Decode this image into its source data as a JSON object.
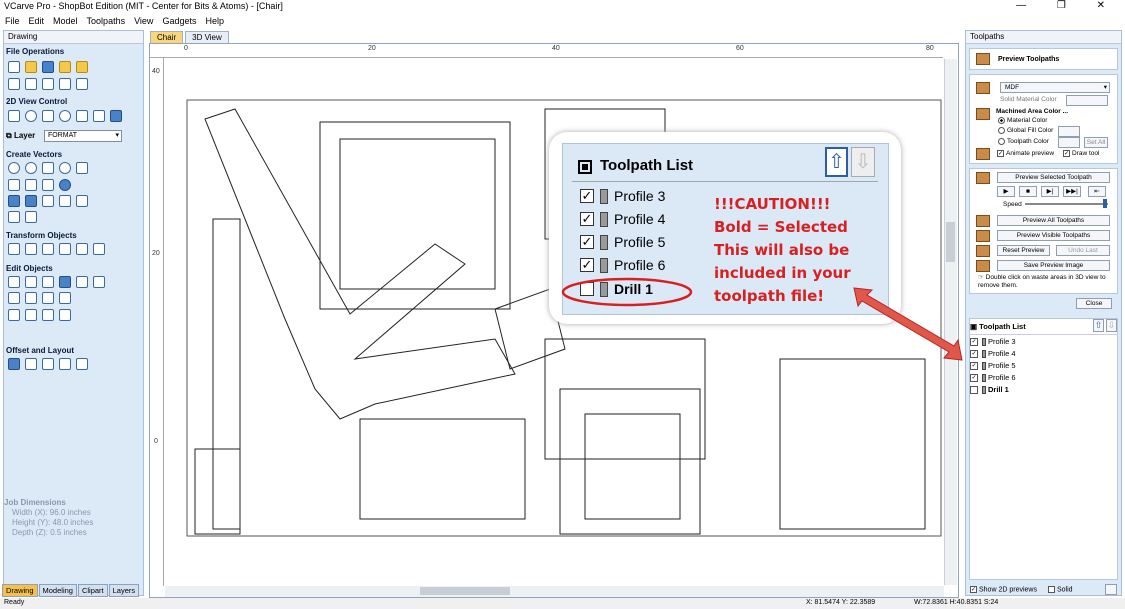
{
  "window": {
    "title": "VCarve Pro - ShopBot Edition (MIT - Center for Bits & Atoms) - [Chair]",
    "min": "—",
    "max": "❐",
    "close": "✕"
  },
  "menu": [
    "File",
    "Edit",
    "Model",
    "Toolpaths",
    "View",
    "Gadgets",
    "Help"
  ],
  "left": {
    "panel_title": "Drawing",
    "sections": {
      "file_operations": "File Operations",
      "view_control": "2D View Control",
      "layer": "Layer",
      "create_vectors": "Create Vectors",
      "transform_objects": "Transform Objects",
      "edit_objects": "Edit Objects",
      "offset_layout": "Offset and Layout"
    },
    "layer_value": "FORMAT",
    "job": {
      "heading": "Job Dimensions",
      "width": "Width  (X): 96.0 inches",
      "height": "Height (Y): 48.0 inches",
      "depth": "Depth  (Z): 0.5 inches"
    },
    "tabs": [
      "Drawing",
      "Modeling",
      "Clipart",
      "Layers"
    ]
  },
  "doc_tabs": [
    "Chair",
    "3D View"
  ],
  "ruler": {
    "h": [
      "0",
      "20",
      "40",
      "60",
      "80"
    ],
    "v": [
      "40",
      "20",
      "0"
    ]
  },
  "callout": {
    "title": "Toolpath List",
    "items": [
      {
        "label": "Profile 3",
        "check": "✓",
        "bold": false
      },
      {
        "label": "Profile 4",
        "check": "✓",
        "bold": false
      },
      {
        "label": "Profile 5",
        "check": "✓",
        "bold": false
      },
      {
        "label": "Profile 6",
        "check": "✓",
        "bold": false
      },
      {
        "label": "Drill 1",
        "check": "",
        "bold": true
      }
    ],
    "caution": [
      "!!!CAUTION!!!",
      "Bold = Selected",
      "This will also be",
      "included in your",
      "toolpath file!"
    ],
    "up_arrow": "⇧",
    "down_arrow": "⇩",
    "accent_color": "#d92020"
  },
  "right": {
    "panel_title": "Toolpaths",
    "preview_toolpaths": "Preview Toolpaths",
    "material": "MDF",
    "solid_material_color": "Solid Material Color",
    "machined_area_color": "Machined Area Color ...",
    "material_color": "Material Color",
    "global_fill_color": "Global Fill Color",
    "toolpath_color": "Toolpath Color",
    "set_all": "Set All",
    "animate_preview": "Animate preview",
    "draw_tool": "Draw tool",
    "preview_selected": "Preview Selected Toolpath",
    "playback": [
      "▶",
      "■",
      "▶|",
      "▶▶|",
      "⇤"
    ],
    "speed": "Speed",
    "preview_all": "Preview All Toolpaths",
    "preview_visible": "Preview Visible Toolpaths",
    "reset_preview": "Reset Preview",
    "undo_last": "Undo Last",
    "save_preview_image": "Save Preview Image",
    "hint": "Double click on waste areas in 3D view to remove them.",
    "close": "Close",
    "toolpath_list_title": "Toolpath List",
    "toolpath_items": [
      {
        "label": "Profile 3",
        "check": "✓",
        "bold": false
      },
      {
        "label": "Profile 4",
        "check": "✓",
        "bold": false
      },
      {
        "label": "Profile 5",
        "check": "✓",
        "bold": false
      },
      {
        "label": "Profile 6",
        "check": "✓",
        "bold": false
      },
      {
        "label": "Drill 1",
        "check": "",
        "bold": true
      }
    ],
    "show_2d": "Show 2D previews",
    "solid": "Solid"
  },
  "status": {
    "ready": "Ready",
    "xy": "X: 81.5474 Y: 22.3589",
    "wh": "W:72.8361  H:40.8351  S:24"
  }
}
